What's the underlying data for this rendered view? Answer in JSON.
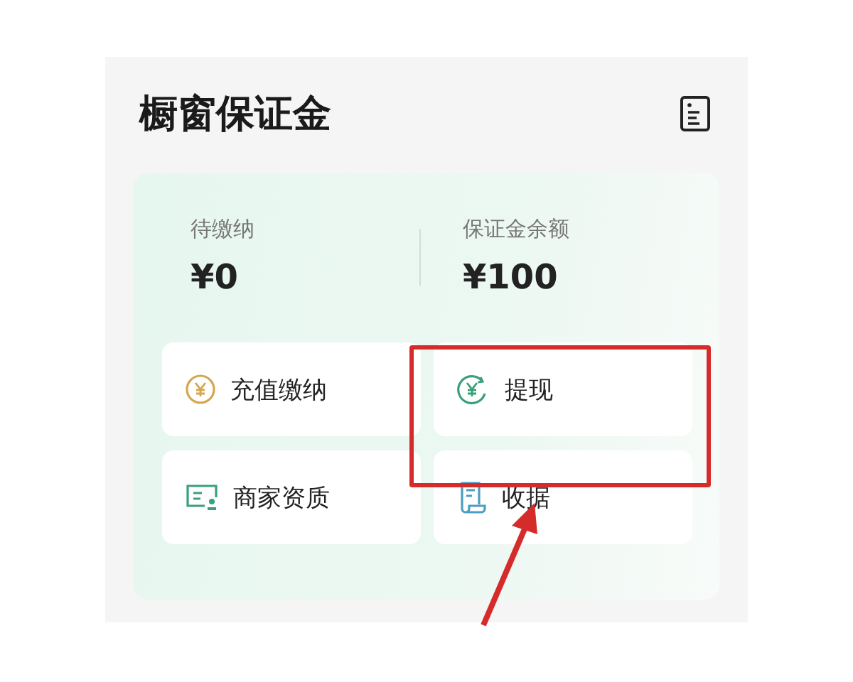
{
  "page": {
    "title": "橱窗保证金"
  },
  "summary": [
    {
      "label": "待缴纳",
      "amount": "¥0"
    },
    {
      "label": "保证金余额",
      "amount": "¥100"
    }
  ],
  "actions": [
    {
      "kind": "recharge",
      "label": "充值缴纳"
    },
    {
      "kind": "withdraw",
      "label": "提现"
    },
    {
      "kind": "qualification",
      "label": "商家资质"
    },
    {
      "kind": "receipt",
      "label": "收据"
    }
  ]
}
